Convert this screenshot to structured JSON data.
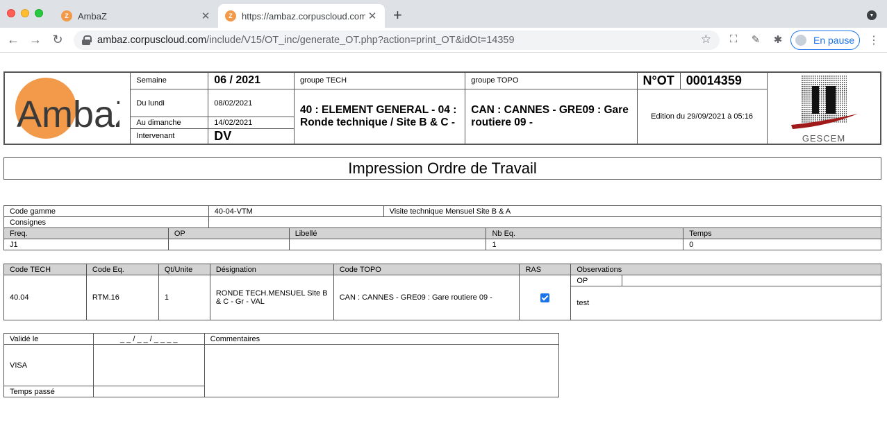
{
  "browser": {
    "tabs": [
      {
        "title": "AmbaZ",
        "active": false
      },
      {
        "title": "https://ambaz.corpuscloud.com",
        "active": true
      }
    ],
    "url_host": "ambaz.corpuscloud.com",
    "url_path": "/include/V15/OT_inc/generate_OT.php?action=print_OT&idOt=14359",
    "profile_label": "En pause"
  },
  "header": {
    "logo_text": "AmbaZ",
    "semaine_label": "Semaine",
    "semaine_value": "06 / 2021",
    "du_lundi_label": "Du lundi",
    "du_lundi_value": "08/02/2021",
    "au_dimanche_label": "Au dimanche",
    "au_dimanche_value": "14/02/2021",
    "intervenant_label": "Intervenant",
    "intervenant_value": "DV",
    "groupe_tech_label": "groupe TECH",
    "groupe_tech_value": "40 : ELEMENT GENERAL - 04 : Ronde technique / Site B & C -",
    "groupe_topo_label": "groupe TOPO",
    "groupe_topo_value": "CAN : CANNES - GRE09 : Gare routiere 09 -",
    "not_label": "N°OT",
    "not_value": "00014359",
    "edition": "Edition du 29/09/2021 à 05:16",
    "gescem_text": "GESCEM"
  },
  "title": "Impression Ordre de Travail",
  "gamme": {
    "code_gamme_label": "Code gamme",
    "code_gamme_value": "40-04-VTM",
    "gamme_desc": "Visite technique Mensuel Site B & A",
    "consignes_label": "Consignes",
    "columns": [
      "Freq.",
      "OP",
      "Libellé",
      "Nb Eq.",
      "Temps"
    ],
    "row": [
      "J1",
      "",
      "",
      "1",
      "0"
    ]
  },
  "operations": {
    "columns": [
      "Code TECH",
      "Code Eq.",
      "Qt/Unite",
      "Désignation",
      "Code TOPO",
      "RAS",
      "Observations"
    ],
    "row": {
      "code_tech": "40.04",
      "code_eq": "RTM.16",
      "qt": "1",
      "designation": "RONDE TECH.MENSUEL Site B & C - Gr - VAL",
      "code_topo": "CAN : CANNES - GRE09 : Gare routiere 09 -",
      "ras_checked": true,
      "op_label": "OP",
      "observation": "test"
    }
  },
  "validation": {
    "valide_le_label": "Validé le",
    "date_placeholder": "_ _ / _ _ / _ _ _ _",
    "commentaires_label": "Commentaires",
    "visa_label": "VISA",
    "temps_passe_label": "Temps passé"
  }
}
